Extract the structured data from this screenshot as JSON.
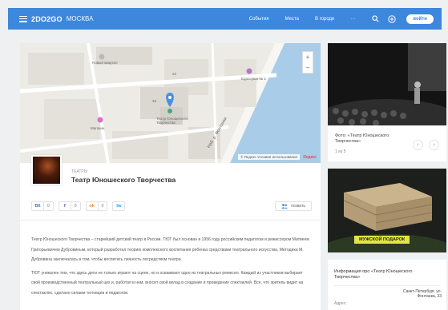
{
  "header": {
    "logo": "2DO2GO",
    "city": "МОСКВА",
    "nav": [
      "События",
      "Места",
      "В городе"
    ],
    "more": "···",
    "login": "войти"
  },
  "map": {
    "labels": {
      "block": "Новый квартал",
      "place": "Театр Юношеского Творчества",
      "shop": "Магазин",
      "venue": "Едоссуши № 1",
      "street": "Наб. р. Фонтанки",
      "house1": "33",
      "house2": "22"
    },
    "footer": "© Яндекс Условия использования",
    "yandex": "Яндекс",
    "zoom_in": "+",
    "zoom_out": "−"
  },
  "event": {
    "category": "ТЕАТРЫ",
    "title": "Театр Юношеского Творчества"
  },
  "social": {
    "vk_icon": "ВК",
    "vk_count": "0",
    "fb_icon": "f",
    "fb_count": "0",
    "ok_icon": "ok",
    "ok_count": "0",
    "tw_icon": "tw",
    "invite": "позвать"
  },
  "description": {
    "p1": "Театр Юношеского Творчества – старейший детский театр в России. ТЮТ был основан в 1956 году российским педагогом и режиссером Матвеем Григорьевичем Дубровиным, который разработал теорию комплексного воспитания ребенка средствами театрального искусства. Методика М. Дубровина заключалась в том, чтобы воспитать личность посредством театра.",
    "p2": "ТЮТ уникален тем, что здесь дети не только играют на сцене, но и осваивают одно из театральных ремесел. Каждый из участников выбирает свой производственный театральный цех и, работая в нем, вносит свой вклад в создание и проведение спектаклей. Все, что зритель видит на спектаклях, сделано силами тютовцев и педагогов."
  },
  "sidebar": {
    "photo_caption": "Фото: «Театр Юношеского Творчества»",
    "photo_count": "1 из 5",
    "prev": "‹",
    "next": "›",
    "ad_label": "МУЖСКОЙ ПОДАРОК",
    "info_title": "Информация про «Театр Юношеского Творчества»",
    "address_key": "Адрес:",
    "address_value": "Санкт-Петербург, ул. Фонтанка, 33"
  },
  "colors": {
    "header": "#3d87dd",
    "accent": "#3d87dd",
    "ad_label": "#e3e640"
  }
}
